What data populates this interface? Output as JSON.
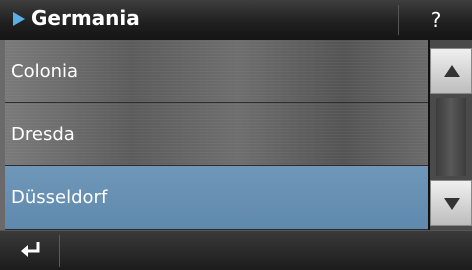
{
  "header": {
    "title": "Germania",
    "help_label": "?"
  },
  "list": {
    "items": [
      {
        "label": "Colonia",
        "selected": false
      },
      {
        "label": "Dresda",
        "selected": false
      },
      {
        "label": "Düsseldorf",
        "selected": true
      }
    ]
  },
  "icons": {
    "title_marker": "play-icon",
    "scroll_up": "arrow-up-icon",
    "scroll_down": "arrow-down-icon",
    "back": "return-icon"
  },
  "colors": {
    "selected_row": "#6590b5",
    "title_marker": "#5aaee8"
  }
}
